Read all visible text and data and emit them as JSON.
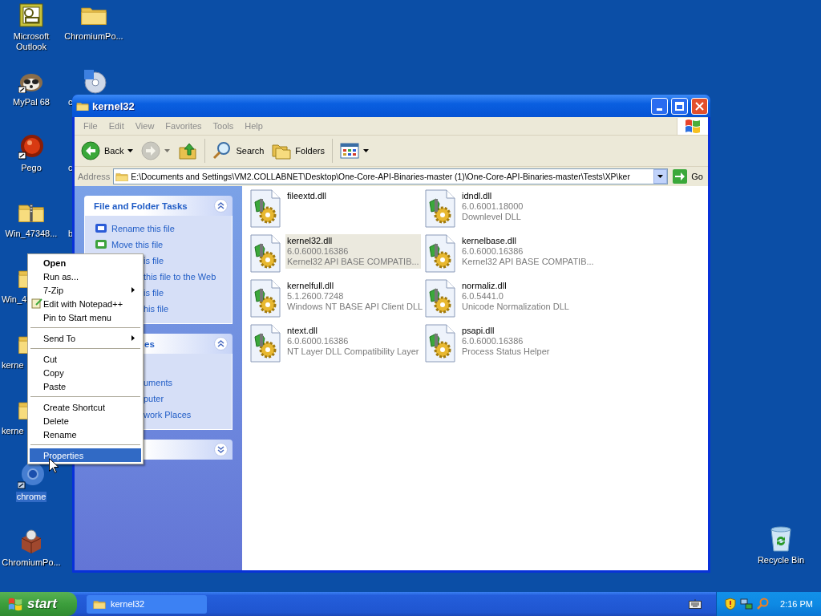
{
  "desktop_icons": [
    {
      "label": "Microsoft Outlook",
      "kind": "outlook",
      "selected": false,
      "covered": false
    },
    {
      "label": "MyPal 68",
      "kind": "raccoon",
      "selected": false,
      "covered": false
    },
    {
      "label": "Pego",
      "kind": "red-ball",
      "selected": false,
      "covered": false
    },
    {
      "label": "Win_47348...",
      "kind": "zip-folder",
      "selected": false,
      "covered": false
    },
    {
      "label": "Win_4",
      "kind": "folder",
      "selected": false,
      "covered": true
    },
    {
      "label": "kerne",
      "kind": "zip-folder",
      "selected": false,
      "covered": true
    },
    {
      "label": "kerne",
      "kind": "folder",
      "selected": false,
      "covered": true
    },
    {
      "label": "chrome",
      "kind": "chrome",
      "selected": true,
      "covered": false
    },
    {
      "label": "ChromiumPo...",
      "kind": "box",
      "selected": false,
      "covered": false
    },
    {
      "label": "ChromiumPo...",
      "kind": "folder",
      "selected": false,
      "covered": false
    },
    {
      "label": "c",
      "kind": "disc",
      "selected": false,
      "covered": true
    },
    {
      "label": "c",
      "kind": "none",
      "selected": false,
      "covered": true
    },
    {
      "label": "b",
      "kind": "none",
      "selected": false,
      "covered": true
    }
  ],
  "recycle_bin": {
    "label": "Recycle Bin"
  },
  "window": {
    "title": "kernel32",
    "menu": [
      "File",
      "Edit",
      "View",
      "Favorites",
      "Tools",
      "Help"
    ],
    "toolbar": [
      {
        "kind": "back",
        "label": "Back",
        "disabled": false
      },
      {
        "kind": "forward",
        "disabled": true
      },
      {
        "kind": "up",
        "disabled": false
      },
      {
        "kind": "search",
        "label": "Search",
        "disabled": false
      },
      {
        "kind": "folders",
        "label": "Folders",
        "disabled": false
      },
      {
        "kind": "views",
        "disabled": false
      }
    ],
    "address": {
      "label": "Address",
      "value": "E:\\Documents and Settings\\VM2.COLLABNET\\Desktop\\One-Core-API-Binaries-master (1)\\One-Core-API-Binaries-master\\Tests\\XP\\ker",
      "go": "Go"
    },
    "task_panels": [
      {
        "title": "File and Folder Tasks",
        "title_covered": false,
        "expanded": true,
        "items": [
          {
            "text": "Rename this file",
            "kind": "rename",
            "covered": false
          },
          {
            "text": "Move this file",
            "kind": "move",
            "covered": false
          },
          {
            "text": "is file",
            "covered": true
          },
          {
            "text": "this file to the Web",
            "covered": true
          },
          {
            "text": "is file",
            "covered": true
          },
          {
            "text": "his file",
            "covered": true
          }
        ]
      },
      {
        "title": "es",
        "title_covered": true,
        "expanded": true,
        "items": [
          {
            "text": "uments",
            "covered": true
          },
          {
            "text": "puter",
            "covered": true
          },
          {
            "text": "work Places",
            "covered": true
          }
        ]
      },
      {
        "expanded": false
      }
    ],
    "files": [
      {
        "name": "fileextd.dll",
        "selected": false
      },
      {
        "name": "idndl.dll",
        "version": "6.0.6001.18000",
        "description": "Downlevel DLL",
        "selected": false
      },
      {
        "name": "kernel32.dll",
        "version": "6.0.6000.16386",
        "description": "Kernel32 API BASE COMPATIB...",
        "selected": true
      },
      {
        "name": "kernelbase.dll",
        "version": "6.0.6000.16386",
        "description": "Kernel32 API BASE COMPATIB...",
        "selected": false
      },
      {
        "name": "kernelfull.dll",
        "version": "5.1.2600.7248",
        "description": "Windows NT BASE API Client DLL",
        "selected": false
      },
      {
        "name": "normaliz.dll",
        "version": "6.0.5441.0",
        "description": "Unicode Normalization DLL",
        "selected": false
      },
      {
        "name": "ntext.dll",
        "version": "6.0.6000.16386",
        "description": "NT Layer DLL Compatibility Layer",
        "selected": false
      },
      {
        "name": "psapi.dll",
        "version": "6.0.6000.16386",
        "description": "Process Status Helper",
        "selected": false
      }
    ]
  },
  "context_menu": [
    {
      "label": "Open",
      "kind": "default",
      "selected": false
    },
    {
      "label": "Run as...",
      "kind": "item",
      "selected": false
    },
    {
      "label": "7-Zip",
      "kind": "submenu",
      "selected": false
    },
    {
      "label": "Edit with Notepad++",
      "kind": "icon",
      "selected": false
    },
    {
      "label": "Pin to Start menu",
      "kind": "item",
      "selected": false
    },
    {
      "kind": "separator"
    },
    {
      "label": "Send To",
      "kind": "submenu",
      "selected": false
    },
    {
      "kind": "separator"
    },
    {
      "label": "Cut",
      "kind": "item",
      "selected": false
    },
    {
      "label": "Copy",
      "kind": "item",
      "selected": false
    },
    {
      "label": "Paste",
      "kind": "item",
      "selected": false
    },
    {
      "kind": "separator"
    },
    {
      "label": "Create Shortcut",
      "kind": "item",
      "selected": false
    },
    {
      "label": "Delete",
      "kind": "item",
      "selected": false
    },
    {
      "label": "Rename",
      "kind": "item",
      "selected": false
    },
    {
      "kind": "separator"
    },
    {
      "label": "Properties",
      "kind": "item",
      "selected": true
    }
  ],
  "taskbar": {
    "start": "start",
    "tasks": [
      {
        "label": "kernel32",
        "selected": false
      }
    ],
    "clock": "2:16 PM"
  }
}
